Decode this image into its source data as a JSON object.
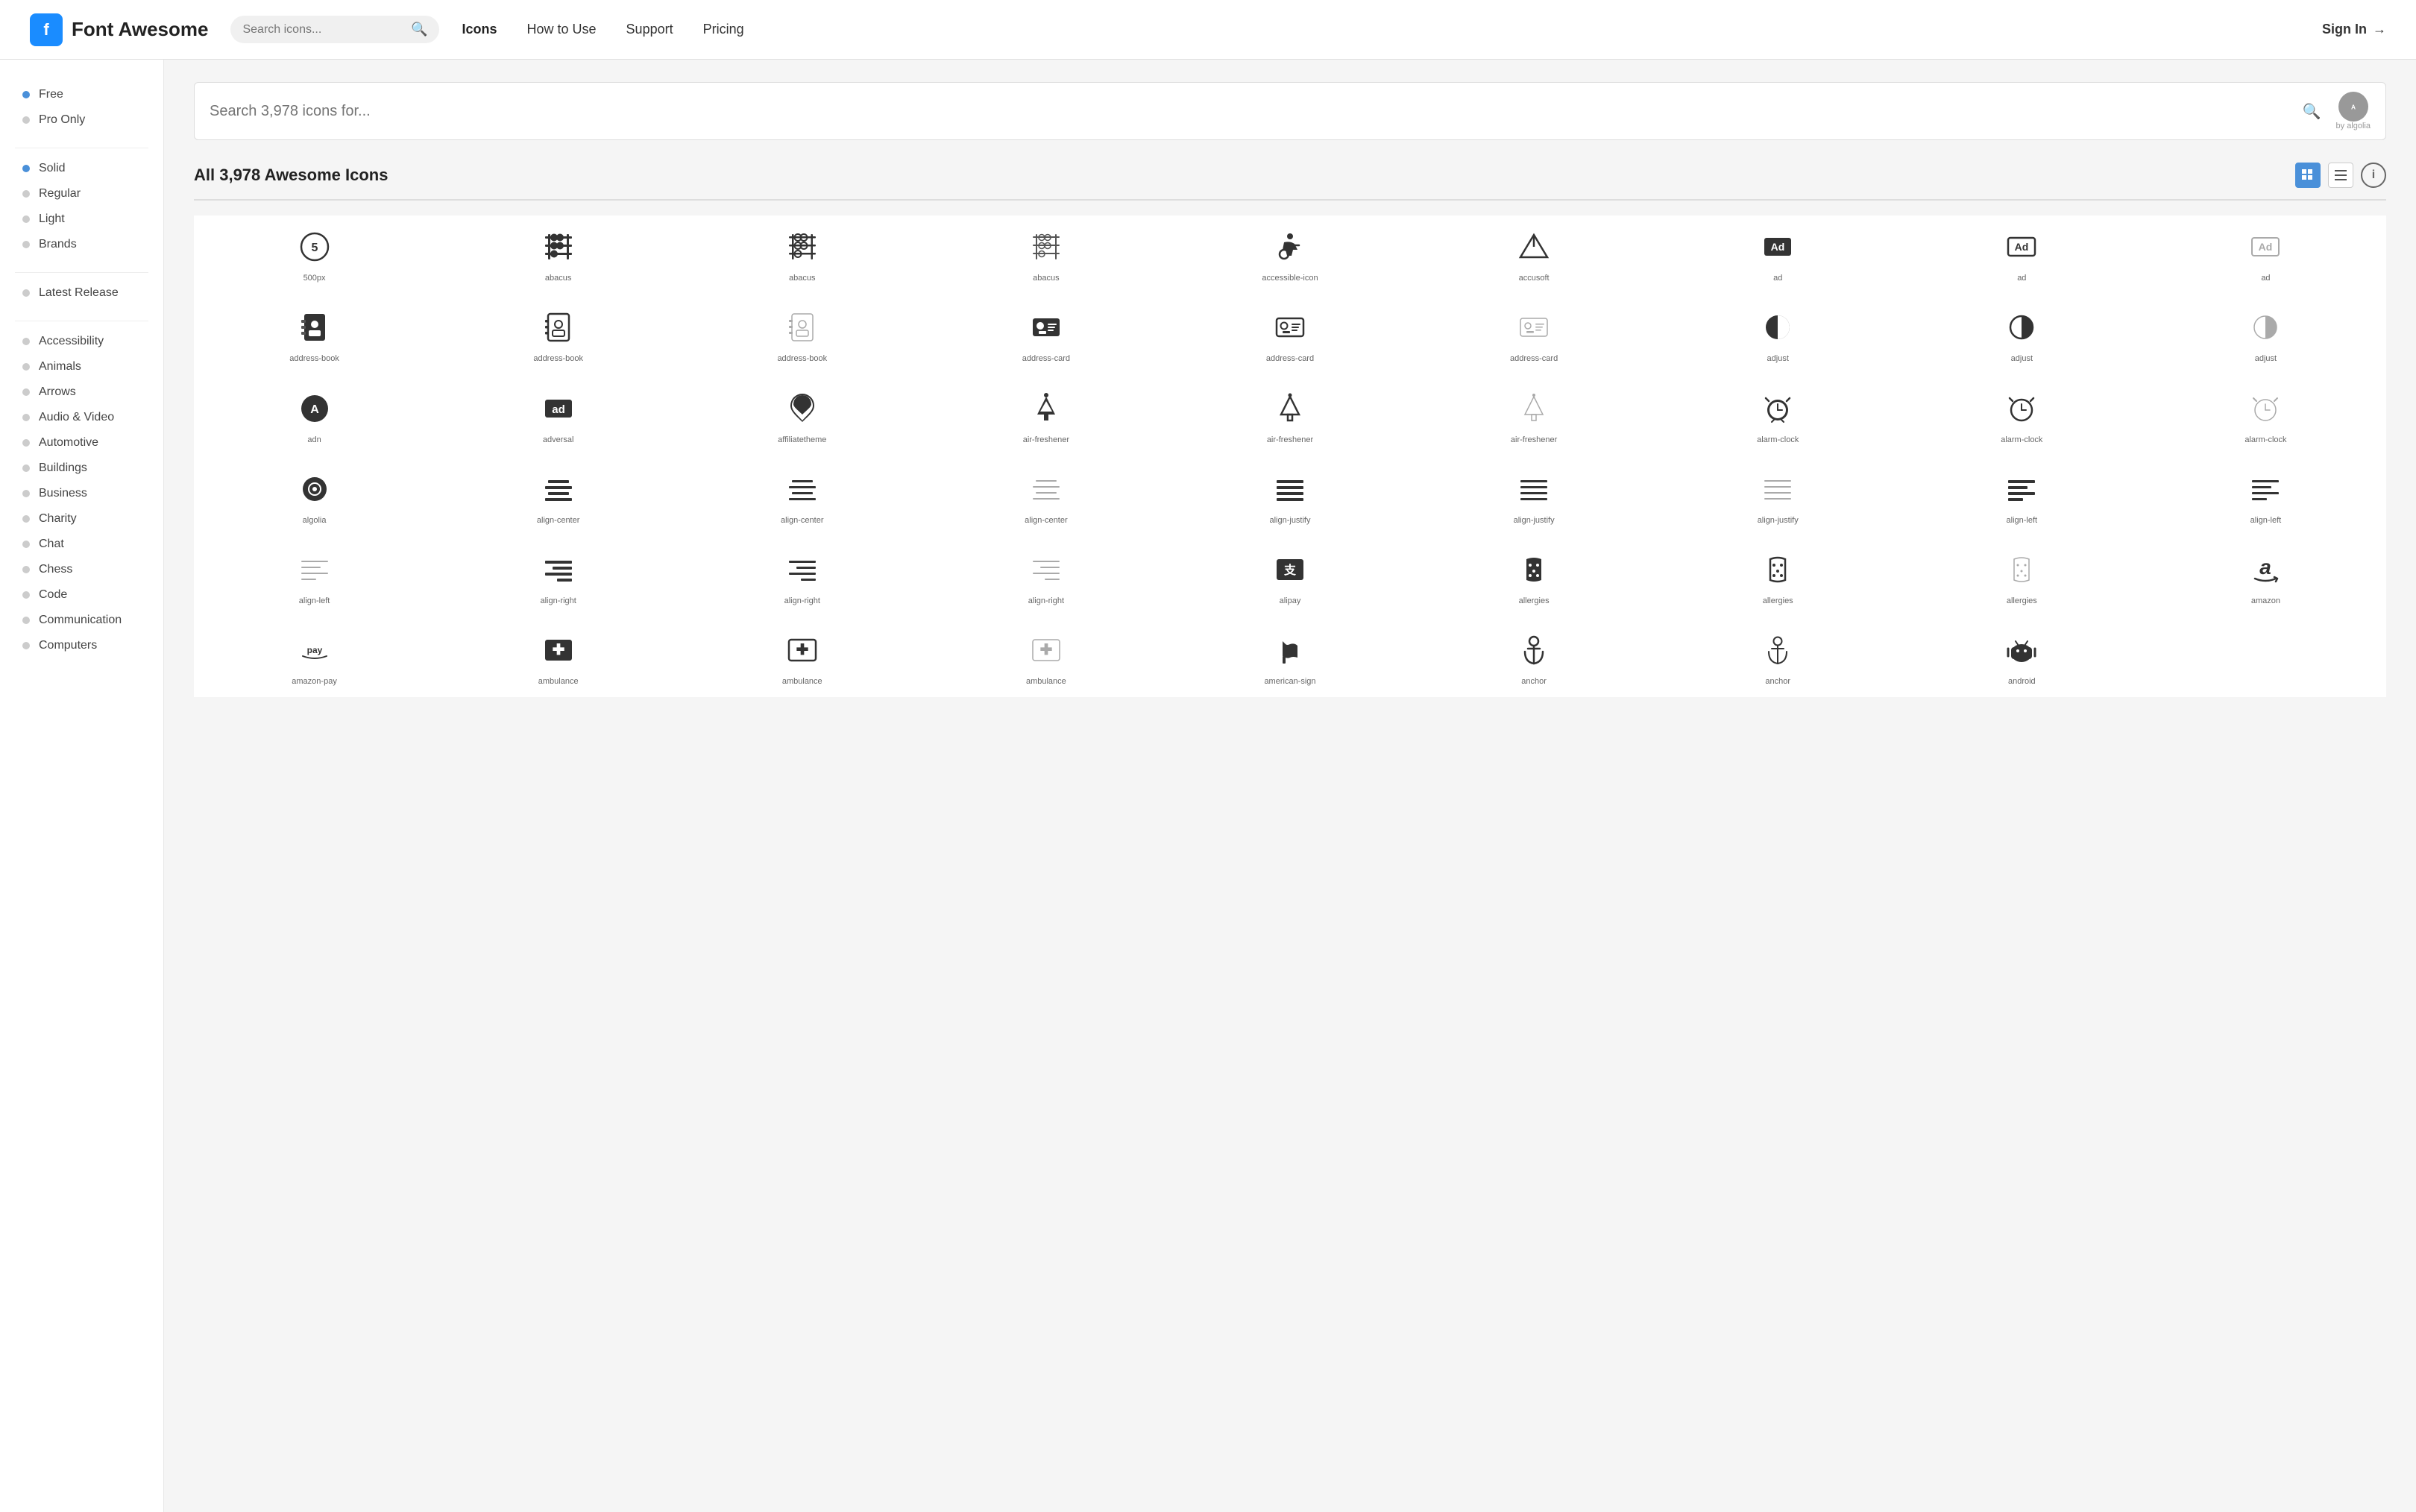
{
  "header": {
    "logo_icon": "f",
    "logo_text": "Font Awesome",
    "search_placeholder": "Search icons...",
    "nav_items": [
      {
        "label": "Icons",
        "active": true
      },
      {
        "label": "How to Use",
        "active": false
      },
      {
        "label": "Support",
        "active": false
      },
      {
        "label": "Pricing",
        "active": false
      }
    ],
    "sign_in_label": "Sign In"
  },
  "sidebar": {
    "filter_section": [
      {
        "label": "Free",
        "dot": "blue"
      },
      {
        "label": "Pro Only",
        "dot": "default"
      }
    ],
    "style_section": [
      {
        "label": "Solid",
        "dot": "blue"
      },
      {
        "label": "Regular",
        "dot": "default"
      },
      {
        "label": "Light",
        "dot": "default"
      },
      {
        "label": "Brands",
        "dot": "default"
      }
    ],
    "release_section": [
      {
        "label": "Latest Release",
        "dot": "default"
      }
    ],
    "category_section": [
      {
        "label": "Accessibility"
      },
      {
        "label": "Animals"
      },
      {
        "label": "Arrows"
      },
      {
        "label": "Audio & Video"
      },
      {
        "label": "Automotive"
      },
      {
        "label": "Buildings"
      },
      {
        "label": "Business"
      },
      {
        "label": "Charity"
      },
      {
        "label": "Chat"
      },
      {
        "label": "Chess"
      },
      {
        "label": "Code"
      },
      {
        "label": "Communication"
      },
      {
        "label": "Computers"
      }
    ]
  },
  "main": {
    "big_search_placeholder": "Search 3,978 icons for...",
    "algolia_label": "by algolia",
    "grid_title": "All 3,978 Awesome Icons",
    "icons": [
      {
        "name": "500px",
        "glyph": "⑤"
      },
      {
        "name": "abacus",
        "glyph": "▦"
      },
      {
        "name": "abacus",
        "glyph": "▦"
      },
      {
        "name": "abacus",
        "glyph": "▦"
      },
      {
        "name": "accessible-icon",
        "glyph": "♿"
      },
      {
        "name": "accusoft",
        "glyph": "△"
      },
      {
        "name": "ad",
        "glyph": "Ad"
      },
      {
        "name": "ad",
        "glyph": "Ad"
      },
      {
        "name": "ad",
        "glyph": "Ad"
      },
      {
        "name": "address-book",
        "glyph": "📖"
      },
      {
        "name": "address-book",
        "glyph": "📖"
      },
      {
        "name": "address-book",
        "glyph": "📖"
      },
      {
        "name": "address-card",
        "glyph": "📋"
      },
      {
        "name": "address-card",
        "glyph": "📋"
      },
      {
        "name": "address-card",
        "glyph": "📋"
      },
      {
        "name": "adjust",
        "glyph": "◑"
      },
      {
        "name": "adjust",
        "glyph": "◑"
      },
      {
        "name": "adjust",
        "glyph": "◑"
      },
      {
        "name": "adn",
        "glyph": "Ⓐ"
      },
      {
        "name": "adversal",
        "glyph": "ad"
      },
      {
        "name": "affiliatetheme",
        "glyph": "☾"
      },
      {
        "name": "air-freshener",
        "glyph": "🌲"
      },
      {
        "name": "air-freshener",
        "glyph": "🌲"
      },
      {
        "name": "air-freshener",
        "glyph": "🌲"
      },
      {
        "name": "alarm-clock",
        "glyph": "⏰"
      },
      {
        "name": "alarm-clock",
        "glyph": "⏰"
      },
      {
        "name": "alarm-clock",
        "glyph": "⏰"
      },
      {
        "name": "algolia",
        "glyph": "⊙"
      },
      {
        "name": "align-center",
        "glyph": "≡"
      },
      {
        "name": "align-center",
        "glyph": "≡"
      },
      {
        "name": "align-center",
        "glyph": "≡"
      },
      {
        "name": "align-justify",
        "glyph": "≡"
      },
      {
        "name": "align-justify",
        "glyph": "≡"
      },
      {
        "name": "align-justify",
        "glyph": "≡"
      },
      {
        "name": "align-left",
        "glyph": "≡"
      },
      {
        "name": "align-left",
        "glyph": "≡"
      },
      {
        "name": "align-left",
        "glyph": "≡"
      },
      {
        "name": "align-right",
        "glyph": "≡"
      },
      {
        "name": "align-right",
        "glyph": "≡"
      },
      {
        "name": "align-right",
        "glyph": "≡"
      },
      {
        "name": "alipay",
        "glyph": "支"
      },
      {
        "name": "allergies",
        "glyph": "✋"
      },
      {
        "name": "allergies",
        "glyph": "✋"
      },
      {
        "name": "allergies",
        "glyph": "✋"
      },
      {
        "name": "amazon",
        "glyph": "a"
      },
      {
        "name": "amazon-pay",
        "glyph": "pay"
      },
      {
        "name": "ambulance",
        "glyph": "✚"
      },
      {
        "name": "ambulance",
        "glyph": "✚"
      },
      {
        "name": "ambulance",
        "glyph": "✚"
      },
      {
        "name": "american-sign",
        "glyph": "🤟"
      },
      {
        "name": "anchor",
        "glyph": "⚓"
      },
      {
        "name": "anchor",
        "glyph": "⚓"
      },
      {
        "name": "android",
        "glyph": "🤖"
      }
    ]
  }
}
